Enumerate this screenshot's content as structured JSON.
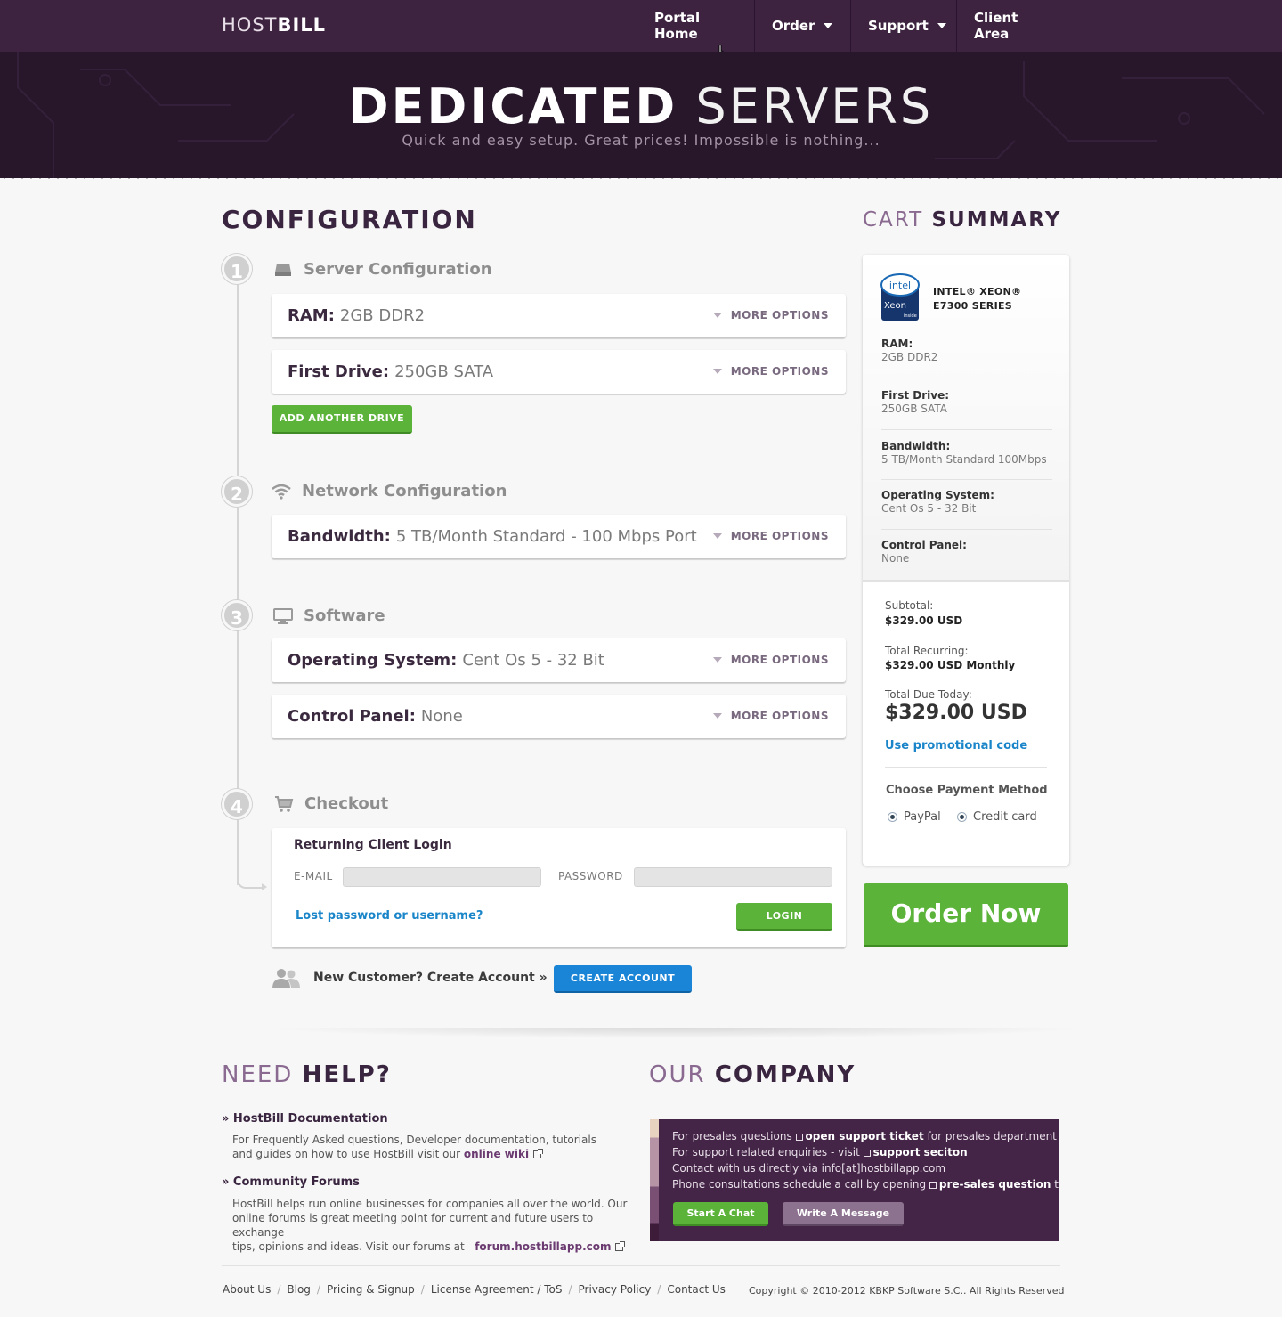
{
  "logo": {
    "light": "HOST",
    "bold": "BILL"
  },
  "nav": {
    "portal_home": "Portal Home",
    "order": "Order",
    "support": "Support",
    "client_area": "Client Area"
  },
  "hero": {
    "title_bold": "DEDICATED",
    "title_light": "SERVERS",
    "subtitle": "Quick and easy setup. Great prices! Impossible is nothing..."
  },
  "configuration": {
    "heading": "CONFIGURATION",
    "more_options": "MORE OPTIONS",
    "steps": [
      {
        "number": "1",
        "title": "Server Configuration"
      },
      {
        "number": "2",
        "title": "Network Configuration"
      },
      {
        "number": "3",
        "title": "Software"
      },
      {
        "number": "4",
        "title": "Checkout"
      }
    ],
    "options": {
      "ram": {
        "label": "RAM:",
        "value": "2GB DDR2"
      },
      "first_drive": {
        "label": "First Drive:",
        "value": "250GB SATA"
      },
      "bandwidth": {
        "label": "Bandwidth:",
        "value": "5 TB/Month Standard - 100 Mbps Port"
      },
      "os": {
        "label": "Operating System:",
        "value": "Cent Os 5 - 32 Bit"
      },
      "control_panel": {
        "label": "Control Panel:",
        "value": "None"
      }
    },
    "add_drive_label": "ADD ANOTHER DRIVE"
  },
  "login": {
    "title": "Returning Client Login",
    "email_label": "E-MAIL",
    "password_label": "PASSWORD",
    "email_value": "",
    "password_value": "",
    "lost_link": "Lost password or username?",
    "login_button": "LOGIN"
  },
  "new_customer": {
    "text": "New Customer? Create Account »",
    "button": "CREATE ACCOUNT"
  },
  "cart": {
    "heading_light": "CART",
    "heading_bold": "SUMMARY",
    "cpu_logo_text": {
      "brand": "intel",
      "product": "Xeon",
      "tag": "inside"
    },
    "cpu_name_line1": "INTEL® XEON®",
    "cpu_name_line2": "E7300 SERIES",
    "items": [
      {
        "label": "RAM:",
        "value": "2GB DDR2"
      },
      {
        "label": "First Drive:",
        "value": "250GB SATA"
      },
      {
        "label": "Bandwidth:",
        "value": "5 TB/Month Standard 100Mbps"
      },
      {
        "label": "Operating System:",
        "value": "Cent Os 5 - 32 Bit"
      },
      {
        "label": "Control Panel:",
        "value": "None"
      }
    ],
    "subtotal_label": "Subtotal:",
    "subtotal_value": "$329.00 USD",
    "recurring_label": "Total Recurring:",
    "recurring_value": "$329.00 USD Monthly",
    "due_label": "Total Due Today:",
    "due_value": "$329.00 USD",
    "promo_link": "Use promotional code",
    "payment_title": "Choose Payment Method",
    "payment_options": [
      "PayPal",
      "Credit card"
    ]
  },
  "order_button": "Order Now",
  "help": {
    "heading_light": "NEED",
    "heading_bold": "HELP?",
    "doc_title": "» HostBill Documentation",
    "doc_text_1": "For Frequently Asked questions, Developer documentation, tutorials",
    "doc_text_2": "and guides on how to use HostBill visit our",
    "doc_link": "online wiki",
    "forum_title": "» Community Forums",
    "forum_text_1": "HostBill helps run online businesses for companies all over the world. Our",
    "forum_text_2": "online forums is great meeting point for current and future users to exchange",
    "forum_text_3": "tips, opinions and ideas. Visit our forums at",
    "forum_link": "forum.hostbillapp.com"
  },
  "company": {
    "heading_light": "OUR",
    "heading_bold": "COMPANY",
    "line1_a": "For presales questions",
    "line1_b": "open support ticket",
    "line1_c": "for presales department",
    "line2_a": "For support related enquiries - visit",
    "line2_b": "support seciton",
    "line3": "Contact with us directly via info[at]hostbillapp.com",
    "line4_a": "Phone consultations schedule a call by opening",
    "line4_b": "pre-sales question",
    "line4_c": "ticket",
    "chat_button": "Start A Chat",
    "message_button": "Write A Message"
  },
  "footer": {
    "links": [
      "About Us",
      "Blog",
      "Pricing & Signup",
      "License Agreement / ToS",
      "Privacy Policy",
      "Contact Us"
    ],
    "copyright": "Copyright © 2010-2012 KBKP Software S.C.. All Rights Reserved"
  },
  "colors": {
    "topbar": "#3d2340",
    "hero": "#28172b",
    "green": "#5bb33a",
    "blue": "#1a85d6",
    "link": "#1a85c9"
  }
}
